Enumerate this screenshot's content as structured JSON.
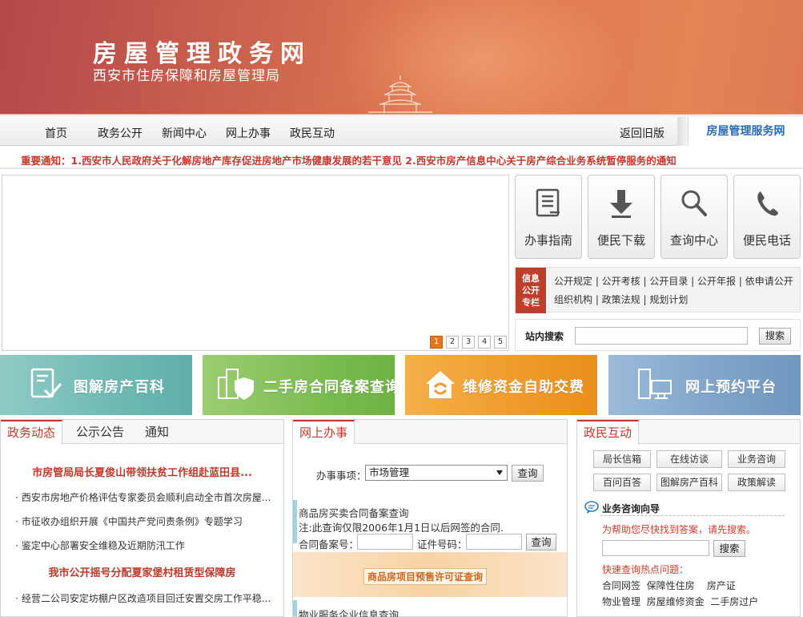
{
  "header": {
    "title": "房屋管理政务网",
    "subtitle": "西安市住房保障和房屋管理局"
  },
  "nav": {
    "items": [
      "首页",
      "政务公开",
      "新闻中心",
      "网上办事",
      "政民互动"
    ],
    "old_version": "返回旧版",
    "service_tab": "房屋管理服务网"
  },
  "notice": {
    "text": "重要通知：1.西安市人民政府关于化解房地产库存促进房地产市场健康发展的若干意见  2.西安市房产信息中心关于房产综合业务系统暂停服务的通知"
  },
  "slider": {
    "pages": [
      "1",
      "2",
      "3",
      "4",
      "5"
    ],
    "active_page": 1
  },
  "quick_links": [
    {
      "label": "办事指南",
      "icon": "document-list-icon"
    },
    {
      "label": "便民下载",
      "icon": "download-arrow-icon"
    },
    {
      "label": "查询中心",
      "icon": "magnifier-icon"
    },
    {
      "label": "便民电话",
      "icon": "phone-icon"
    }
  ],
  "info_open": {
    "tag": [
      "信息",
      "公开",
      "专栏"
    ],
    "row1": "公开规定 | 公开考核 | 公开目录 | 公开年报 | 依申请公开",
    "row2": "组织机构 | 政策法规 | 规划计划"
  },
  "site_search": {
    "label": "站内搜索",
    "button": "搜索"
  },
  "features": [
    {
      "label": "图解房产百科",
      "color": "#6fb9b4"
    },
    {
      "label": "二手房合同备案查询",
      "color": "#7cbd53"
    },
    {
      "label": "维修资金自助交费",
      "color": "#ef9b2b"
    },
    {
      "label": "网上预约平台",
      "color": "#7ea3c8"
    }
  ],
  "news_panel": {
    "tabs": [
      "政务动态",
      "公示公告",
      "通知"
    ],
    "headline1": "市房管局局长夏俊山带领扶贫工作组赴蓝田县...",
    "items1": [
      "西安市房地产价格评估专家委员会顺利启动全市首次房屋...",
      "市征收办组织开展《中国共产党问责条例》专题学习",
      "鉴定中心部署安全维稳及近期防汛工作"
    ],
    "headline2": "我市公开摇号分配夏家堡村租赁型保障房",
    "items2": [
      "经营二公司安定坊棚户区改造项目回迁安置交房工作平稳..."
    ]
  },
  "online_panel": {
    "tab": "网上办事",
    "matter_label": "办事事项：",
    "matter_value": "市场管理",
    "query_btn": "查询",
    "contract_title": "商品房买卖合同备案查询",
    "contract_note": "注:此查询仅限2006年1月1日以后网签的合同.",
    "record_label": "合同备案号：",
    "cert_label": "证件号码：",
    "presale_banner": "商品房项目预售许可证查询",
    "property_title": "物业服务企业信息查询"
  },
  "interaction_panel": {
    "tab": "政民互动",
    "buttons": [
      "局长信箱",
      "在线访谈",
      "业务咨询",
      "百问百答",
      "图解房产百科",
      "政策解读"
    ],
    "guide_title": "业务咨询向导",
    "guide_hint": "为帮助您尽快找到答案，请先搜索。",
    "search_btn": "搜索",
    "hot_label": "快速查询热点问题：",
    "hot_row1": "合同网签  保障性住房    房产证",
    "hot_row2": "物业管理  房屋维修资金  二手房过户"
  }
}
